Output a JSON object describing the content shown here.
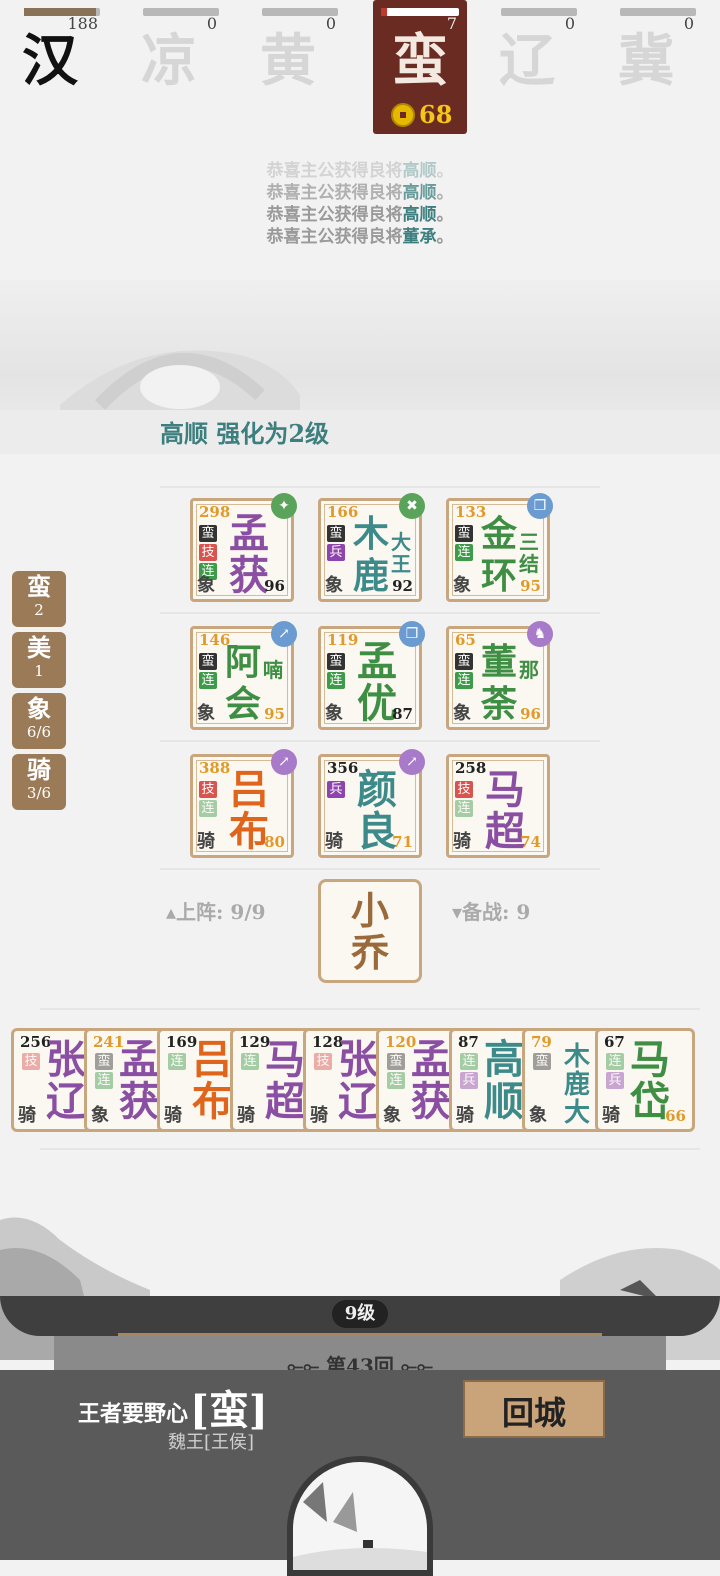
{
  "factions": [
    {
      "name": "汉",
      "count": "188",
      "fill": 0.95,
      "state": "first"
    },
    {
      "name": "凉",
      "count": "0",
      "fill": 0,
      "state": "dim"
    },
    {
      "name": "黄",
      "count": "0",
      "fill": 0,
      "state": "dim"
    },
    {
      "name": "蛮",
      "count": "7",
      "fill": 0.08,
      "state": "active",
      "coins": "68"
    },
    {
      "name": "辽",
      "count": "0",
      "fill": 0,
      "state": "dim"
    },
    {
      "name": "冀",
      "count": "0",
      "fill": 0,
      "state": "dim"
    }
  ],
  "log": [
    {
      "prefix": "恭喜主公获得良将",
      "hero": "高顺",
      "suffix": "。"
    },
    {
      "prefix": "恭喜主公获得良将",
      "hero": "高顺",
      "suffix": "。"
    },
    {
      "prefix": "恭喜主公获得良将",
      "hero": "高顺",
      "suffix": "。"
    },
    {
      "prefix": "恭喜主公获得良将",
      "hero": "董承",
      "suffix": "。"
    }
  ],
  "notice": "高顺 强化为2级",
  "side_tabs": [
    {
      "name": "蛮",
      "value": "2"
    },
    {
      "name": "美",
      "value": "1"
    },
    {
      "name": "象",
      "value": "6/6"
    },
    {
      "name": "骑",
      "value": "3/6"
    }
  ],
  "board": [
    {
      "level": "298",
      "name": "孟获",
      "sub": "",
      "power": "96",
      "cls": "象",
      "tags": [
        "蛮",
        "技",
        "连"
      ],
      "color": "purple",
      "badge": "sword",
      "badge_color": "#5aa35a"
    },
    {
      "level": "166",
      "name": "木鹿",
      "sub": "大王",
      "power": "92",
      "cls": "象",
      "tags": [
        "蛮",
        "兵"
      ],
      "color": "teal",
      "badge": "cross",
      "badge_color": "#5aa35a"
    },
    {
      "level": "133",
      "name": "金环",
      "sub": "三结",
      "power": "95",
      "cls": "象",
      "tags": [
        "蛮",
        "连"
      ],
      "color": "green",
      "badge": "scroll",
      "badge_color": "#6b9bd1"
    },
    {
      "level": "146",
      "name": "阿会",
      "sub": "喃",
      "power": "95",
      "cls": "象",
      "tags": [
        "蛮",
        "连"
      ],
      "color": "green",
      "badge": "spear",
      "badge_color": "#6b9bd1"
    },
    {
      "level": "119",
      "name": "孟优",
      "sub": "",
      "power": "87",
      "cls": "象",
      "tags": [
        "蛮",
        "连"
      ],
      "color": "green",
      "badge": "scroll",
      "badge_color": "#6b9bd1"
    },
    {
      "level": "65",
      "name": "董荼",
      "sub": "那",
      "power": "96",
      "cls": "象",
      "tags": [
        "蛮",
        "连"
      ],
      "color": "green",
      "badge": "shirt",
      "badge_color": "#a77bc9"
    },
    {
      "level": "388",
      "name": "吕布",
      "sub": "",
      "power": "80",
      "cls": "骑",
      "tags": [
        "技",
        "连"
      ],
      "color": "orange",
      "badge": "spear",
      "badge_color": "#a77bc9"
    },
    {
      "level": "356",
      "name": "颜良",
      "sub": "",
      "power": "71",
      "cls": "骑",
      "tags": [
        "兵"
      ],
      "color": "teal",
      "badge": "spear",
      "badge_color": "#a77bc9"
    },
    {
      "level": "258",
      "name": "马超",
      "sub": "",
      "power": "74",
      "cls": "骑",
      "tags": [
        "技",
        "连"
      ],
      "color": "purple",
      "badge": "",
      "badge_color": ""
    }
  ],
  "deploy": {
    "label": "上阵:",
    "value": "9/9"
  },
  "reserve": {
    "label": "备战:",
    "value": "9"
  },
  "selected_hero": "小乔",
  "bench": [
    {
      "level": "256",
      "name": "张辽",
      "cls": "骑",
      "power": "",
      "tags": [
        "技"
      ],
      "color": "purple"
    },
    {
      "level": "241",
      "name": "孟获",
      "cls": "象",
      "power": "",
      "tags": [
        "蛮",
        "连"
      ],
      "color": "purple"
    },
    {
      "level": "169",
      "name": "吕布",
      "cls": "骑",
      "power": "",
      "tags": [
        "连"
      ],
      "color": "orange"
    },
    {
      "level": "129",
      "name": "马超",
      "cls": "骑",
      "power": "",
      "tags": [
        "连"
      ],
      "color": "purple"
    },
    {
      "level": "128",
      "name": "张辽",
      "cls": "骑",
      "power": "",
      "tags": [
        "技"
      ],
      "color": "purple"
    },
    {
      "level": "120",
      "name": "孟获",
      "cls": "象",
      "power": "",
      "tags": [
        "蛮",
        "连"
      ],
      "color": "purple"
    },
    {
      "level": "87",
      "name": "高顺",
      "cls": "骑",
      "power": "",
      "tags": [
        "连",
        "兵"
      ],
      "color": "teal"
    },
    {
      "level": "79",
      "name": "木鹿大",
      "cls": "象",
      "power": "",
      "tags": [
        "蛮"
      ],
      "color": "teal"
    },
    {
      "level": "67",
      "name": "马岱",
      "cls": "骑",
      "power": "66",
      "tags": [
        "连",
        "兵"
      ],
      "color": "green"
    }
  ],
  "player_level": "9级",
  "round": "第43回",
  "king": {
    "label": "王者要野心",
    "faction": "[蛮]",
    "title": "魏王[王侯]"
  },
  "back_button": "回城"
}
